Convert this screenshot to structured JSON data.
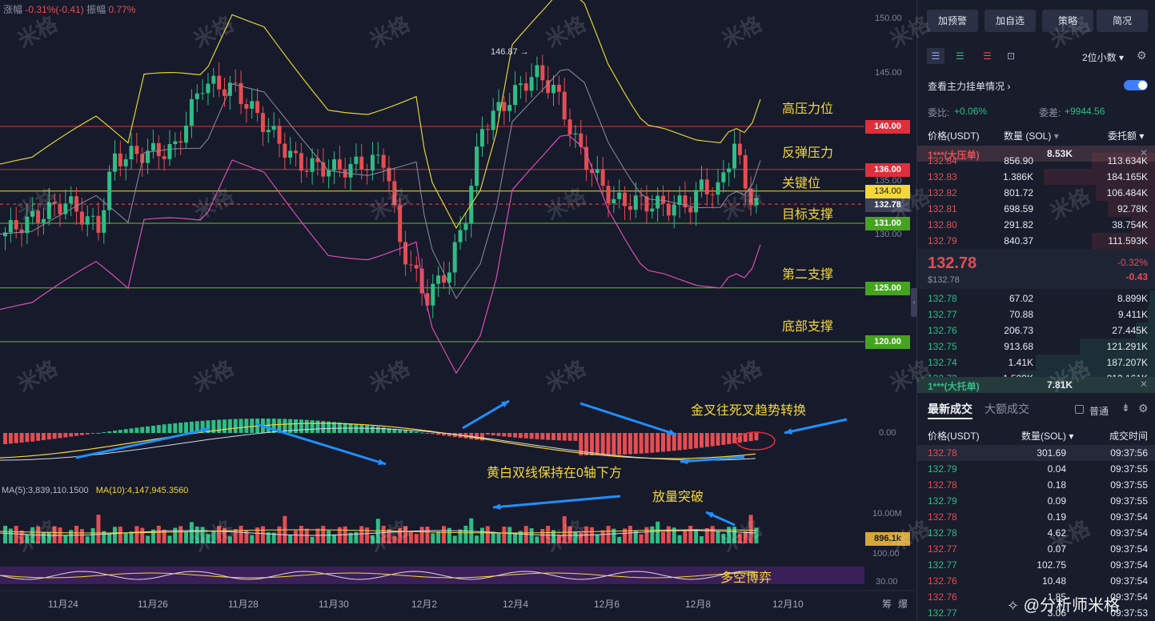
{
  "top_info": {
    "change_label": "涨幅",
    "change_value": "-0.31%(-0.41)",
    "amplitude_label": "振幅",
    "amplitude_value": "0.77%"
  },
  "y_axis": {
    "p150": "150.00",
    "p145": "145.00",
    "p135": "135.00",
    "p130": "130.00",
    "macd_zero": "0.00",
    "vol_max": "10.00M",
    "rsi_100": "100.00",
    "rsi_30": "30.00"
  },
  "price_tags": {
    "t140": "140.00",
    "t136": "136.00",
    "t134": "134.00",
    "current": "132.78",
    "t131": "131.00",
    "t125": "125.00",
    "t120": "120.00",
    "volume": "896.1k"
  },
  "high_marker": "146.87",
  "annotations": {
    "high_resistance": "高压力位",
    "rebound_resistance": "反弹压力",
    "key_level": "关键位",
    "target_support": "目标支撑",
    "second_support": "第二支撑",
    "bottom_support": "底部支撑",
    "cross_switch": "金叉往死叉趋势转换",
    "below_zero": "黄白双线保持在0轴下方",
    "volume_break": "放量突破",
    "bull_bear": "多空博弈"
  },
  "ma_info": {
    "ma5": "MA(5):3,839,110.1500",
    "ma10": "MA(10):4,147,945.3560"
  },
  "x_axis": {
    "d1": "11月24",
    "d2": "11月26",
    "d3": "11月28",
    "d4": "11月30",
    "d5": "12月2",
    "d6": "12月4",
    "d7": "12月6",
    "d8": "12月8",
    "d9": "12月10",
    "r1": "筹",
    "r2": "爆"
  },
  "watermark": "米格",
  "footer_credit": "@分析师米格",
  "panel": {
    "buttons": [
      "加预警",
      "加自选",
      "策略",
      "简况"
    ],
    "precision": "2位小数",
    "main_orders": "查看主力挂单情况",
    "ratio_label": "委比:",
    "ratio_value": "+0.06%",
    "diff_label": "委差:",
    "diff_value": "+9944.56",
    "cols": {
      "price": "价格(USDT)",
      "qty": "数量 (SOL)",
      "total": "委托额"
    },
    "ask_big": {
      "label": "1***(大压单)",
      "qty": "8.53K"
    },
    "asks": [
      {
        "p": "132.84",
        "q": "856.90",
        "t": "113.634K"
      },
      {
        "p": "132.83",
        "q": "1.386K",
        "t": "184.165K"
      },
      {
        "p": "132.82",
        "q": "801.72",
        "t": "106.484K"
      },
      {
        "p": "132.81",
        "q": "698.59",
        "t": "92.78K"
      },
      {
        "p": "132.80",
        "q": "291.82",
        "t": "38.754K"
      },
      {
        "p": "132.79",
        "q": "840.37",
        "t": "111.593K"
      }
    ],
    "last_price": "132.78",
    "last_usd": "$132.78",
    "last_pct": "-0.32%",
    "last_chg": "-0.43",
    "bids": [
      {
        "p": "132.78",
        "q": "67.02",
        "t": "8.899K"
      },
      {
        "p": "132.77",
        "q": "70.88",
        "t": "9.411K"
      },
      {
        "p": "132.76",
        "q": "206.73",
        "t": "27.445K"
      },
      {
        "p": "132.75",
        "q": "913.68",
        "t": "121.291K"
      },
      {
        "p": "132.74",
        "q": "1.41K",
        "t": "187.207K"
      },
      {
        "p": "132.73",
        "q": "1.599K",
        "t": "212.161K"
      }
    ],
    "bid_big": {
      "label": "1***(大托单)",
      "qty": "7.81K"
    },
    "trade_tabs": [
      "最新成交",
      "大额成交"
    ],
    "normal_label": "普通",
    "trade_cols": {
      "price": "价格(USDT)",
      "qty": "数量(SOL)",
      "time": "成交时间"
    },
    "trades": [
      {
        "p": "132.78",
        "q": "301.69",
        "t": "09:37:56",
        "s": "red"
      },
      {
        "p": "132.79",
        "q": "0.04",
        "t": "09:37:55",
        "s": "green"
      },
      {
        "p": "132.78",
        "q": "0.18",
        "t": "09:37:55",
        "s": "red"
      },
      {
        "p": "132.79",
        "q": "0.09",
        "t": "09:37:55",
        "s": "green"
      },
      {
        "p": "132.78",
        "q": "0.19",
        "t": "09:37:54",
        "s": "red"
      },
      {
        "p": "132.78",
        "q": "4.62",
        "t": "09:37:54",
        "s": "green"
      },
      {
        "p": "132.77",
        "q": "0.07",
        "t": "09:37:54",
        "s": "red"
      },
      {
        "p": "132.77",
        "q": "102.75",
        "t": "09:37:54",
        "s": "green"
      },
      {
        "p": "132.76",
        "q": "10.48",
        "t": "09:37:54",
        "s": "red"
      },
      {
        "p": "132.76",
        "q": "1.85",
        "t": "09:37:54",
        "s": "red"
      },
      {
        "p": "132.77",
        "q": "3.06",
        "t": "09:37:53",
        "s": "green"
      }
    ]
  },
  "colors": {
    "up": "#2ebd85",
    "down": "#e54d52",
    "bg": "#161a2b",
    "panel": "#181c2b",
    "accent": "#f6d738",
    "resistance": "#e02e3b",
    "support": "#5cc22e"
  }
}
